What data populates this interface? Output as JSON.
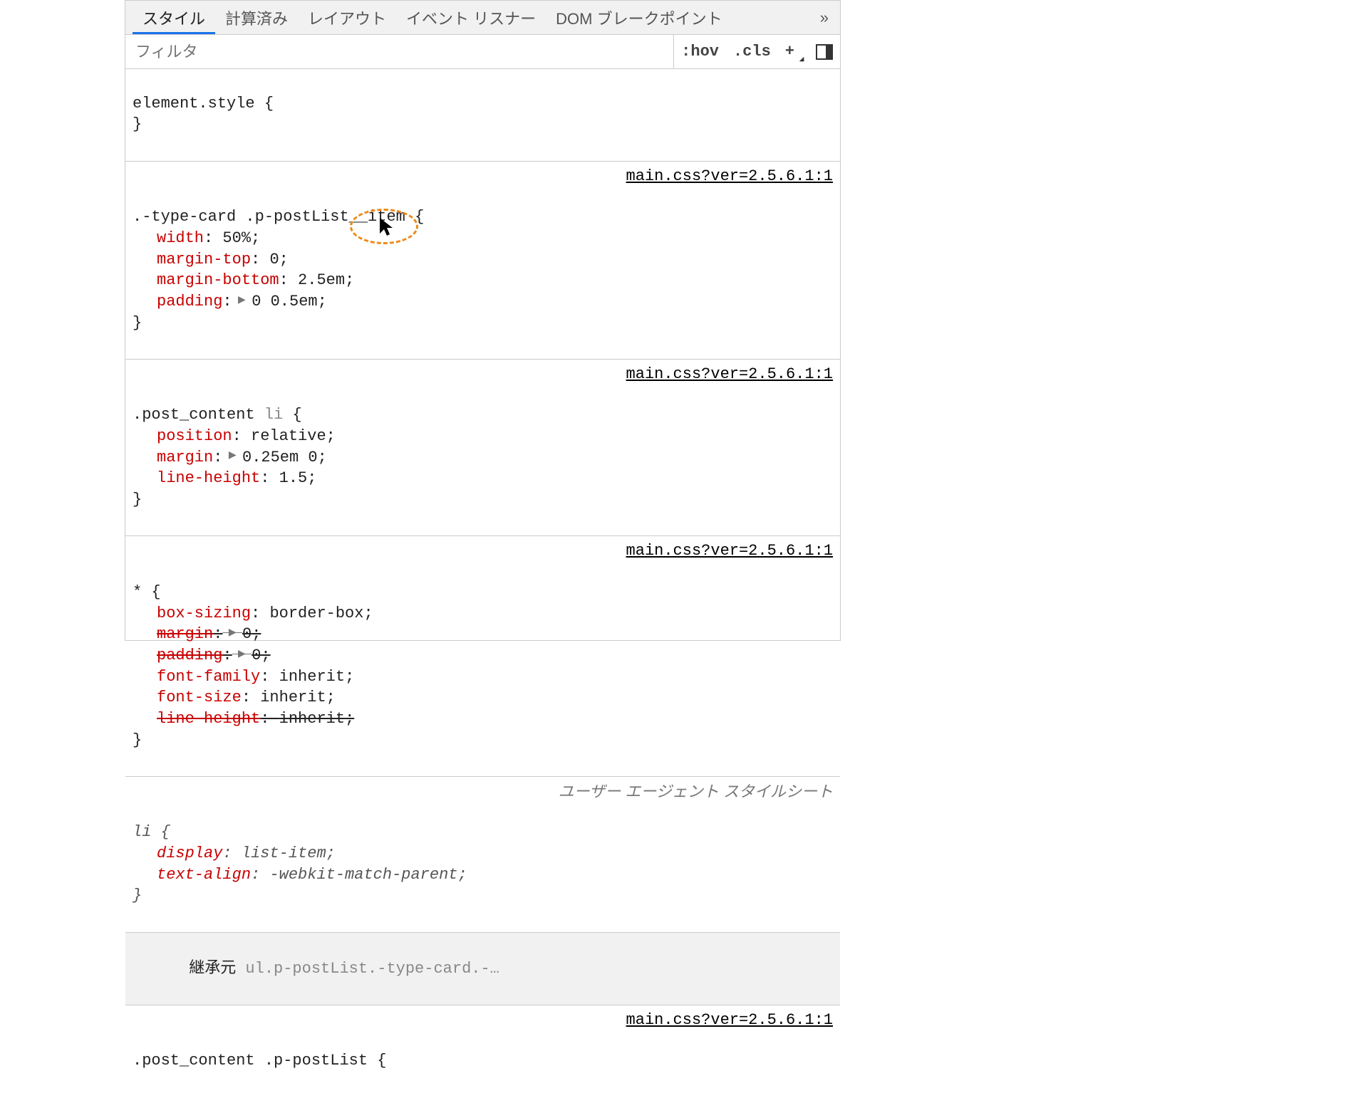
{
  "tabs": {
    "items": [
      "スタイル",
      "計算済み",
      "レイアウト",
      "イベント リスナー",
      "DOM ブレークポイント"
    ],
    "more": "»"
  },
  "filter": {
    "placeholder": "フィルタ",
    "hov": ":hov",
    "cls": ".cls",
    "plus": "+"
  },
  "rules": {
    "r0": {
      "selector": "element.style",
      "open": " {",
      "close": "}"
    },
    "r1": {
      "selector": ".-type-card .p-postList__item",
      "open": " {",
      "close": "}",
      "source": "main.css?ver=2.5.6.1:1",
      "d0p": "width",
      "d0v": "50%",
      "d1p": "margin-top",
      "d1v": "0",
      "d2p": "margin-bottom",
      "d2v": "2.5em",
      "d3p": "padding",
      "d3v": "0 0.5em"
    },
    "r2": {
      "selector_a": ".post_content ",
      "selector_b": "li",
      "open": " {",
      "close": "}",
      "source": "main.css?ver=2.5.6.1:1",
      "d0p": "position",
      "d0v": "relative",
      "d1p": "margin",
      "d1v": "0.25em 0",
      "d2p": "line-height",
      "d2v": "1.5"
    },
    "r3": {
      "selector": "*",
      "open": " {",
      "close": "}",
      "source": "main.css?ver=2.5.6.1:1",
      "d0p": "box-sizing",
      "d0v": "border-box",
      "d1p": "margin",
      "d1v": "0",
      "d2p": "padding",
      "d2v": "0",
      "d3p": "font-family",
      "d3v": "inherit",
      "d4p": "font-size",
      "d4v": "inherit",
      "d5p": "line-height",
      "d5v": "inherit"
    },
    "r4": {
      "selector": "li",
      "open": " {",
      "close": "}",
      "source": "ユーザー エージェント スタイルシート",
      "d0p": "display",
      "d0v": "list-item",
      "d1p": "text-align",
      "d1v": "-webkit-match-parent"
    },
    "inherit_label": "継承元 ",
    "inherit_from": "ul.p-postList.-type-card.-…",
    "r5": {
      "selector": ".post_content .p-postList",
      "open": " {",
      "source": "main.css?ver=2.5.6.1:1"
    }
  }
}
